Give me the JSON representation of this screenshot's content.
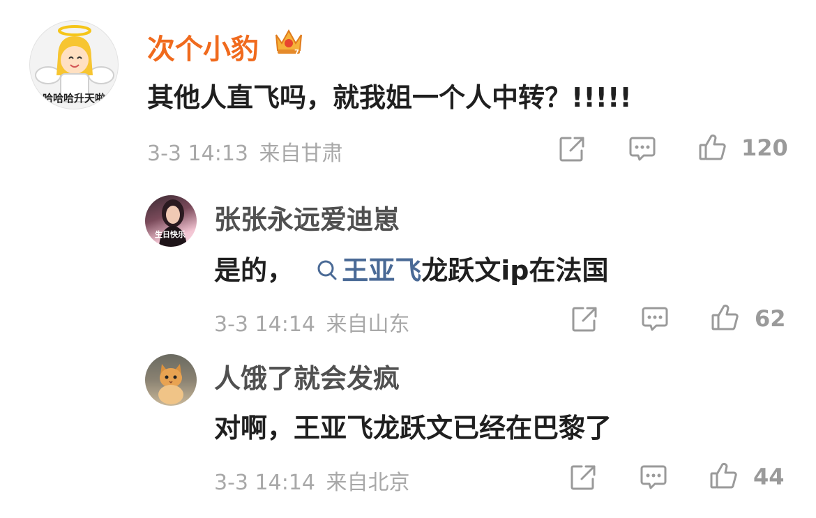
{
  "colors": {
    "vip_name": "#f06a1d",
    "name": "#505050",
    "text": "#1f1f1f",
    "meta": "#a8a8a8",
    "topic_link": "#4a6a96"
  },
  "main_comment": {
    "username": "次个小豹",
    "avatar_text": "哈哈哈升天啦",
    "badge_icon": "crown-icon",
    "text": "其他人直飞吗，就我姐一个人中转？!!!!!",
    "time": "3-3 14:13",
    "location": "来自甘肃",
    "likes": "120"
  },
  "replies": [
    {
      "username": "张张永远爱迪崽",
      "avatar_text": "生日快乐",
      "text_prefix": "是的，",
      "topic_icon": "search-icon",
      "topic": "王亚飞",
      "text_suffix": "龙跃文ip在法国",
      "time": "3-3 14:14",
      "location": "来自山东",
      "likes": "62"
    },
    {
      "username": "人饿了就会发疯",
      "text": "对啊，王亚飞龙跃文已经在巴黎了",
      "time": "3-3 14:14",
      "location": "来自北京",
      "likes": "44"
    }
  ]
}
